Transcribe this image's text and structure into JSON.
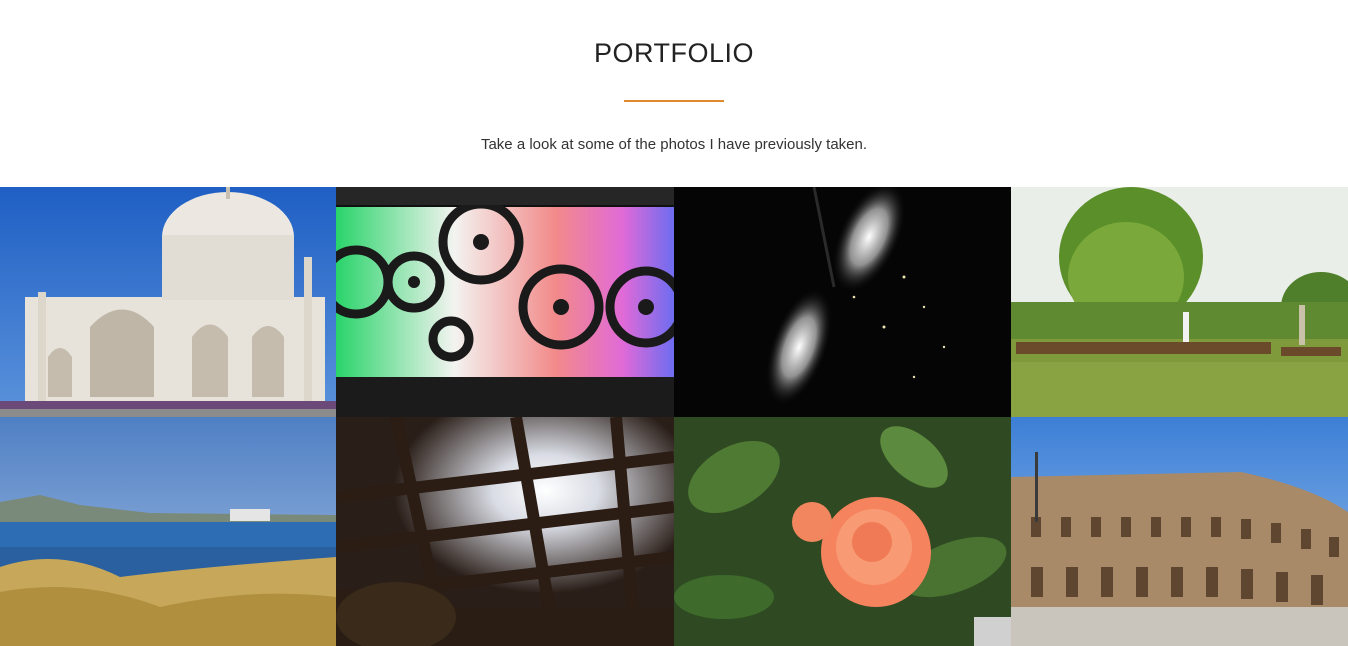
{
  "portfolio": {
    "title": "PORTFOLIO",
    "subtitle": "Take a look at some of the photos I have previously taken.",
    "accent_color": "#e08a2e",
    "photos": [
      {
        "subject": "taj-mahal"
      },
      {
        "subject": "film-reels"
      },
      {
        "subject": "sparkling-fountain"
      },
      {
        "subject": "punting-river"
      },
      {
        "subject": "coastal-bay"
      },
      {
        "subject": "pergola-sunlight"
      },
      {
        "subject": "orange-rose"
      },
      {
        "subject": "colosseum"
      }
    ]
  }
}
